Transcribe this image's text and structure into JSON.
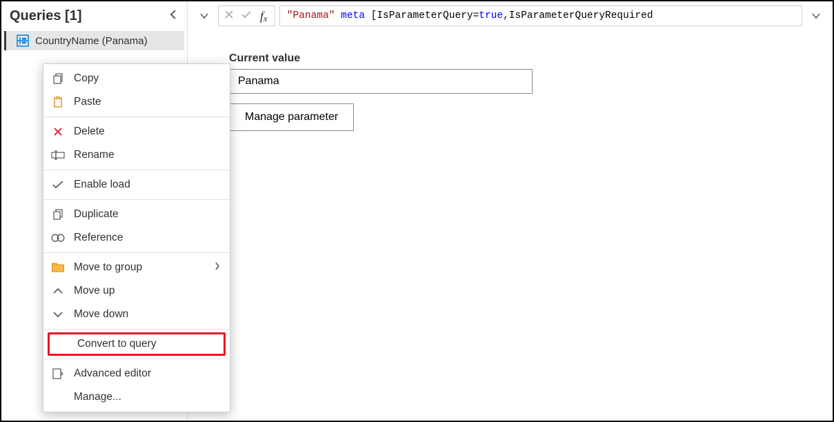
{
  "queries": {
    "title": "Queries [1]",
    "items": [
      {
        "label": "CountryName (Panama)"
      }
    ]
  },
  "formula": {
    "str": "\"Panama\"",
    "kw_meta": "meta",
    "bracket_open": "[",
    "field1": "IsParameterQuery",
    "eq": " = ",
    "true1": "true",
    "comma": ", ",
    "field2": "IsParameterQueryRequired"
  },
  "parameter": {
    "current_value_label": "Current value",
    "current_value": "Panama",
    "manage_label": "Manage parameter"
  },
  "context_menu": {
    "copy": "Copy",
    "paste": "Paste",
    "delete": "Delete",
    "rename": "Rename",
    "enable_load": "Enable load",
    "duplicate": "Duplicate",
    "reference": "Reference",
    "move_to_group": "Move to group",
    "move_up": "Move up",
    "move_down": "Move down",
    "convert_to_query": "Convert to query",
    "advanced_editor": "Advanced editor",
    "manage": "Manage..."
  }
}
